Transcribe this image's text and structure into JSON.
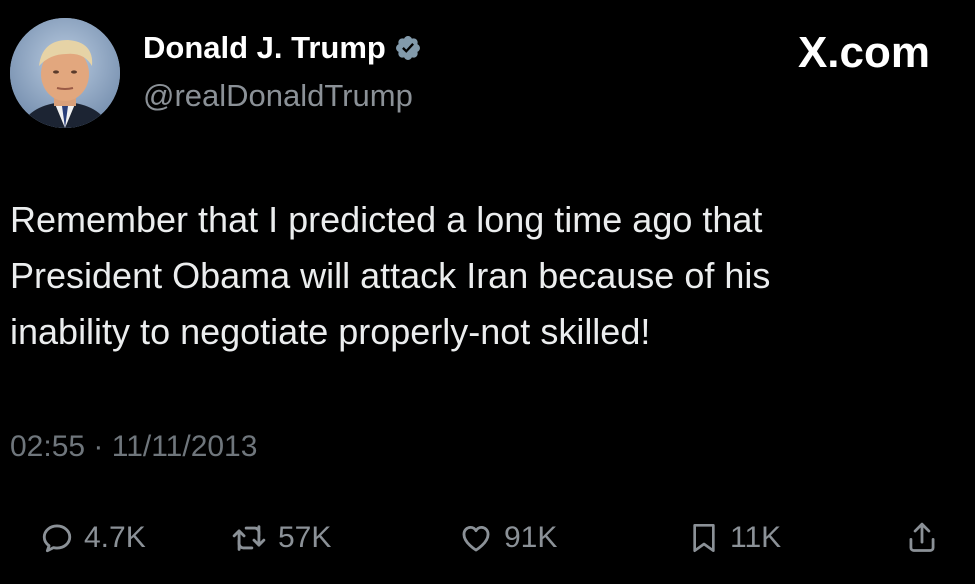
{
  "post": {
    "author": {
      "display_name": "Donald J. Trump",
      "handle": "@realDonaldTrump",
      "verified": true
    },
    "brand": "X.com",
    "text": "Remember that I predicted a long time ago that\nPresident Obama will attack Iran because of his\ninability to negotiate properly-not skilled!",
    "timestamp": "02:55 · 11/11/2013"
  },
  "actions": {
    "replies": "4.7K",
    "reposts": "57K",
    "likes": "91K",
    "bookmarks": "11K"
  },
  "icons": {
    "verified": "verified-badge-icon",
    "reply": "reply-icon",
    "repost": "repost-icon",
    "like": "heart-icon",
    "bookmark": "bookmark-icon",
    "share": "share-icon"
  },
  "colors": {
    "background": "#000000",
    "primary_text": "#e7e9ea",
    "secondary_text": "#8b9197",
    "verified_badge": "#829aab"
  }
}
